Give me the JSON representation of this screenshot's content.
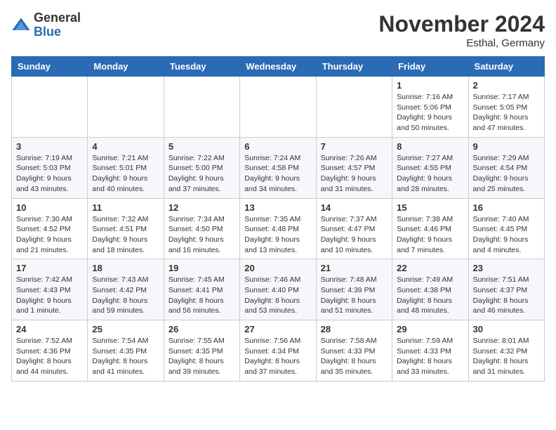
{
  "logo": {
    "general": "General",
    "blue": "Blue"
  },
  "title": "November 2024",
  "subtitle": "Esthal, Germany",
  "days_of_week": [
    "Sunday",
    "Monday",
    "Tuesday",
    "Wednesday",
    "Thursday",
    "Friday",
    "Saturday"
  ],
  "weeks": [
    [
      null,
      null,
      null,
      null,
      null,
      {
        "day": "1",
        "sunrise": "Sunrise: 7:16 AM",
        "sunset": "Sunset: 5:06 PM",
        "daylight": "Daylight: 9 hours and 50 minutes."
      },
      {
        "day": "2",
        "sunrise": "Sunrise: 7:17 AM",
        "sunset": "Sunset: 5:05 PM",
        "daylight": "Daylight: 9 hours and 47 minutes."
      }
    ],
    [
      {
        "day": "3",
        "sunrise": "Sunrise: 7:19 AM",
        "sunset": "Sunset: 5:03 PM",
        "daylight": "Daylight: 9 hours and 43 minutes."
      },
      {
        "day": "4",
        "sunrise": "Sunrise: 7:21 AM",
        "sunset": "Sunset: 5:01 PM",
        "daylight": "Daylight: 9 hours and 40 minutes."
      },
      {
        "day": "5",
        "sunrise": "Sunrise: 7:22 AM",
        "sunset": "Sunset: 5:00 PM",
        "daylight": "Daylight: 9 hours and 37 minutes."
      },
      {
        "day": "6",
        "sunrise": "Sunrise: 7:24 AM",
        "sunset": "Sunset: 4:58 PM",
        "daylight": "Daylight: 9 hours and 34 minutes."
      },
      {
        "day": "7",
        "sunrise": "Sunrise: 7:26 AM",
        "sunset": "Sunset: 4:57 PM",
        "daylight": "Daylight: 9 hours and 31 minutes."
      },
      {
        "day": "8",
        "sunrise": "Sunrise: 7:27 AM",
        "sunset": "Sunset: 4:55 PM",
        "daylight": "Daylight: 9 hours and 28 minutes."
      },
      {
        "day": "9",
        "sunrise": "Sunrise: 7:29 AM",
        "sunset": "Sunset: 4:54 PM",
        "daylight": "Daylight: 9 hours and 25 minutes."
      }
    ],
    [
      {
        "day": "10",
        "sunrise": "Sunrise: 7:30 AM",
        "sunset": "Sunset: 4:52 PM",
        "daylight": "Daylight: 9 hours and 21 minutes."
      },
      {
        "day": "11",
        "sunrise": "Sunrise: 7:32 AM",
        "sunset": "Sunset: 4:51 PM",
        "daylight": "Daylight: 9 hours and 18 minutes."
      },
      {
        "day": "12",
        "sunrise": "Sunrise: 7:34 AM",
        "sunset": "Sunset: 4:50 PM",
        "daylight": "Daylight: 9 hours and 16 minutes."
      },
      {
        "day": "13",
        "sunrise": "Sunrise: 7:35 AM",
        "sunset": "Sunset: 4:48 PM",
        "daylight": "Daylight: 9 hours and 13 minutes."
      },
      {
        "day": "14",
        "sunrise": "Sunrise: 7:37 AM",
        "sunset": "Sunset: 4:47 PM",
        "daylight": "Daylight: 9 hours and 10 minutes."
      },
      {
        "day": "15",
        "sunrise": "Sunrise: 7:38 AM",
        "sunset": "Sunset: 4:46 PM",
        "daylight": "Daylight: 9 hours and 7 minutes."
      },
      {
        "day": "16",
        "sunrise": "Sunrise: 7:40 AM",
        "sunset": "Sunset: 4:45 PM",
        "daylight": "Daylight: 9 hours and 4 minutes."
      }
    ],
    [
      {
        "day": "17",
        "sunrise": "Sunrise: 7:42 AM",
        "sunset": "Sunset: 4:43 PM",
        "daylight": "Daylight: 9 hours and 1 minute."
      },
      {
        "day": "18",
        "sunrise": "Sunrise: 7:43 AM",
        "sunset": "Sunset: 4:42 PM",
        "daylight": "Daylight: 8 hours and 59 minutes."
      },
      {
        "day": "19",
        "sunrise": "Sunrise: 7:45 AM",
        "sunset": "Sunset: 4:41 PM",
        "daylight": "Daylight: 8 hours and 56 minutes."
      },
      {
        "day": "20",
        "sunrise": "Sunrise: 7:46 AM",
        "sunset": "Sunset: 4:40 PM",
        "daylight": "Daylight: 8 hours and 53 minutes."
      },
      {
        "day": "21",
        "sunrise": "Sunrise: 7:48 AM",
        "sunset": "Sunset: 4:39 PM",
        "daylight": "Daylight: 8 hours and 51 minutes."
      },
      {
        "day": "22",
        "sunrise": "Sunrise: 7:49 AM",
        "sunset": "Sunset: 4:38 PM",
        "daylight": "Daylight: 8 hours and 48 minutes."
      },
      {
        "day": "23",
        "sunrise": "Sunrise: 7:51 AM",
        "sunset": "Sunset: 4:37 PM",
        "daylight": "Daylight: 8 hours and 46 minutes."
      }
    ],
    [
      {
        "day": "24",
        "sunrise": "Sunrise: 7:52 AM",
        "sunset": "Sunset: 4:36 PM",
        "daylight": "Daylight: 8 hours and 44 minutes."
      },
      {
        "day": "25",
        "sunrise": "Sunrise: 7:54 AM",
        "sunset": "Sunset: 4:35 PM",
        "daylight": "Daylight: 8 hours and 41 minutes."
      },
      {
        "day": "26",
        "sunrise": "Sunrise: 7:55 AM",
        "sunset": "Sunset: 4:35 PM",
        "daylight": "Daylight: 8 hours and 39 minutes."
      },
      {
        "day": "27",
        "sunrise": "Sunrise: 7:56 AM",
        "sunset": "Sunset: 4:34 PM",
        "daylight": "Daylight: 8 hours and 37 minutes."
      },
      {
        "day": "28",
        "sunrise": "Sunrise: 7:58 AM",
        "sunset": "Sunset: 4:33 PM",
        "daylight": "Daylight: 8 hours and 35 minutes."
      },
      {
        "day": "29",
        "sunrise": "Sunrise: 7:59 AM",
        "sunset": "Sunset: 4:33 PM",
        "daylight": "Daylight: 8 hours and 33 minutes."
      },
      {
        "day": "30",
        "sunrise": "Sunrise: 8:01 AM",
        "sunset": "Sunset: 4:32 PM",
        "daylight": "Daylight: 8 hours and 31 minutes."
      }
    ]
  ]
}
